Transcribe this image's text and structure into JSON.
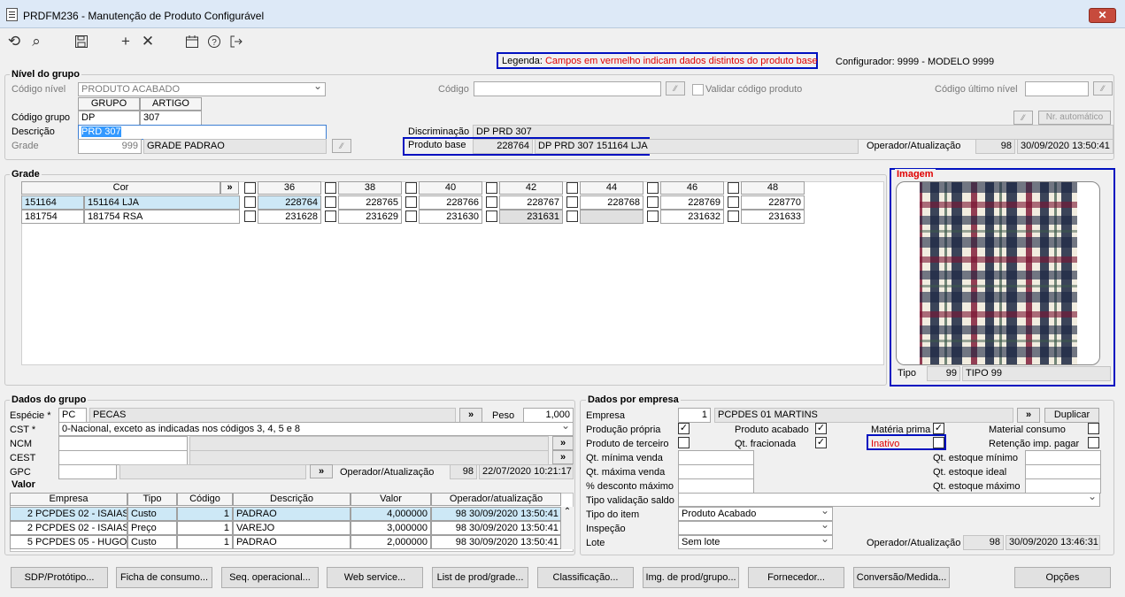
{
  "window": {
    "title": "PRDFM236 - Manutenção de Produto Configurável",
    "close": "✕"
  },
  "legend": {
    "label": "Legenda:",
    "text": "Campos em vermelho indicam dados distintos do produto base"
  },
  "configurador": "Configurador: 9999 - MODELO 9999",
  "nivel": {
    "title": "Nível do grupo",
    "codigo_nivel_label": "Código nível",
    "codigo_nivel_value": "PRODUTO ACABADO",
    "codigo_label": "Código",
    "codigo_value": "",
    "validar_label": "Validar código produto",
    "codigo_ultimo_label": "Código último nível",
    "codigo_ultimo_value": "",
    "grupo_hdr": "GRUPO",
    "artigo_hdr": "ARTIGO",
    "codigo_grupo_label": "Código grupo",
    "grupo_value": "DP",
    "artigo_value": "307",
    "descricao_label": "Descrição",
    "descricao_value": "PRD 307",
    "grade_label": "Grade",
    "grade_num": "999",
    "grade_name": "GRADE PADRAO",
    "nr_automatico": "Nr. automático",
    "discriminacao_label": "Discriminação",
    "discriminacao_value": "DP PRD 307",
    "produto_base_label": "Produto base",
    "produto_base_code": "228764",
    "produto_base_desc": "DP PRD 307 151164 LJA",
    "operador_label": "Operador/Atualização",
    "operador_value": "98",
    "operador_date": "30/09/2020 13:50:41"
  },
  "grade": {
    "title": "Grade",
    "cor_header": "Cor",
    "expand": "»",
    "sizes": [
      "36",
      "38",
      "40",
      "42",
      "44",
      "46",
      "48"
    ],
    "rows": [
      {
        "code": "151164",
        "name": "151164 LJA",
        "values": [
          "228764",
          "228765",
          "228766",
          "228767",
          "228768",
          "228769",
          "228770"
        ]
      },
      {
        "code": "181754",
        "name": "181754 RSA",
        "values": [
          "231628",
          "231629",
          "231630",
          "231631",
          "",
          "231632",
          "231633"
        ]
      }
    ]
  },
  "imagem": {
    "title": "Imagem",
    "tipo_label": "Tipo",
    "tipo_num": "99",
    "tipo_value": "TIPO 99"
  },
  "dados_grupo": {
    "title": "Dados do grupo",
    "especie_label": "Espécie *",
    "especie_code": "PC",
    "especie_name": "PECAS",
    "peso_label": "Peso",
    "peso_value": "1,000",
    "cst_label": "CST *",
    "cst_value": "0-Nacional, exceto as indicadas nos códigos 3, 4, 5 e 8",
    "ncm_label": "NCM",
    "cest_label": "CEST",
    "gpc_label": "GPC",
    "operador_label": "Operador/Atualização",
    "operador_value": "98",
    "operador_date": "22/07/2020 10:21:17",
    "expand": "»"
  },
  "valor": {
    "title": "Valor",
    "headers": [
      "Empresa",
      "Tipo",
      "Código",
      "Descrição",
      "Valor",
      "Operador/atualização"
    ],
    "rows": [
      {
        "num": "2",
        "empresa": "PCPDES 02 - ISAIAS",
        "tipo": "Custo",
        "codigo": "1",
        "descricao": "PADRAO",
        "valor": "4,000000",
        "op": "98",
        "data": "30/09/2020 13:50:41"
      },
      {
        "num": "2",
        "empresa": "PCPDES 02 - ISAIAS",
        "tipo": "Preço",
        "codigo": "1",
        "descricao": "VAREJO",
        "valor": "3,000000",
        "op": "98",
        "data": "30/09/2020 13:50:41"
      },
      {
        "num": "5",
        "empresa": "PCPDES 05 - HUGO",
        "tipo": "Custo",
        "codigo": "1",
        "descricao": "PADRAO",
        "valor": "2,000000",
        "op": "98",
        "data": "30/09/2020 13:50:41"
      }
    ]
  },
  "dados_empresa": {
    "title": "Dados por empresa",
    "empresa_label": "Empresa",
    "empresa_num": "1",
    "empresa_name": "PCPDES 01 MARTINS",
    "duplicar": "Duplicar",
    "producao_propria": "Produção própria",
    "produto_acabado": "Produto acabado",
    "materia_prima": "Matéria prima",
    "material_consumo": "Material consumo",
    "produto_terceiro": "Produto de terceiro",
    "qt_fracionada": "Qt. fracionada",
    "inativo": "Inativo",
    "retencao": "Retenção imp. pagar",
    "qt_min_venda": "Qt. mínima venda",
    "qt_max_venda": "Qt. máxima venda",
    "desconto_max": "% desconto máximo",
    "qt_est_min": "Qt. estoque mínimo",
    "qt_est_ideal": "Qt. estoque ideal",
    "qt_est_max": "Qt. estoque máximo",
    "tipo_validacao": "Tipo validação saldo",
    "tipo_item_label": "Tipo do item",
    "tipo_item_value": "Produto Acabado",
    "inspecao_label": "Inspeção",
    "lote_label": "Lote",
    "lote_value": "Sem lote",
    "operador_label": "Operador/Atualização",
    "operador_value": "98",
    "operador_date": "30/09/2020 13:46:31"
  },
  "buttons": [
    "SDP/Protótipo...",
    "Ficha de consumo...",
    "Seq. operacional...",
    "Web service...",
    "List de prod/grade...",
    "Classificação...",
    "Img. de prod/grupo...",
    "Fornecedor...",
    "Conversão/Medida...",
    "Opções"
  ],
  "colors": {
    "red": "#e00000",
    "blue_border": "#0010c0",
    "selected": "#cde8f6"
  }
}
